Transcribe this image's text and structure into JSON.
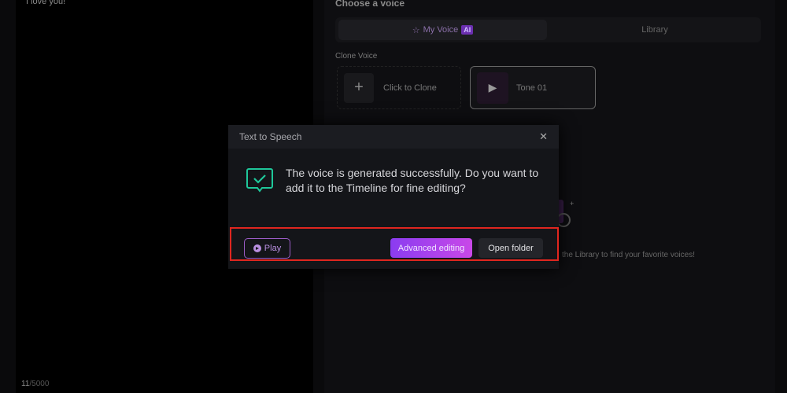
{
  "editor": {
    "text": "I love you!",
    "count_current": "11",
    "count_max": "/5000"
  },
  "voice_panel": {
    "heading": "Choose a voice",
    "tabs": [
      {
        "label": "My Voice",
        "badge": "AI",
        "icon": "star-icon"
      },
      {
        "label": "Library"
      }
    ],
    "clone_section": "Clone Voice",
    "clone_card": "Click to Clone",
    "tone_card": "Tone 01",
    "hint": "the Library to find your favorite voices!"
  },
  "dialog": {
    "title": "Text to Speech",
    "message": "The voice is generated successfully. Do you want to add it to the Timeline for fine editing?",
    "play": "Play",
    "advanced": "Advanced editing",
    "open_folder": "Open folder"
  },
  "colors": {
    "accent": "#9b5cc7",
    "success": "#1fc79a",
    "highlight": "#e0261f"
  }
}
